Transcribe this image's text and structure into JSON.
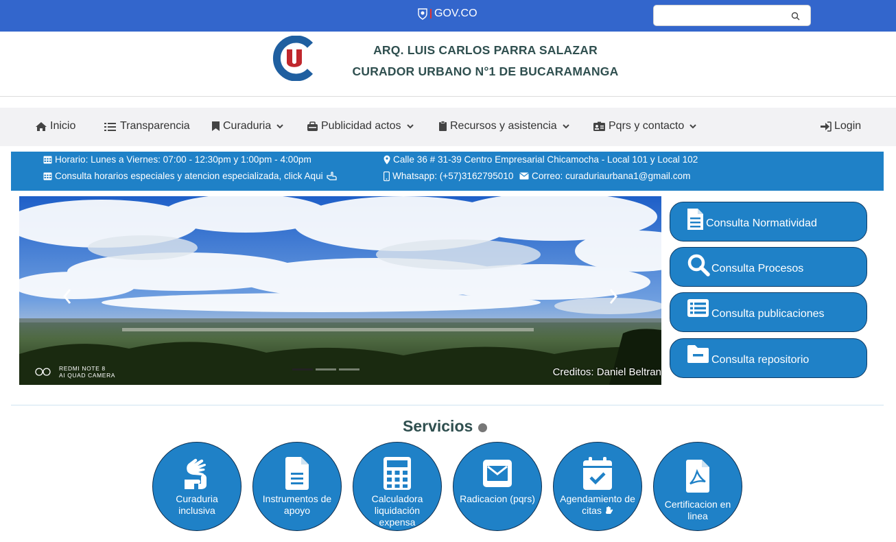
{
  "govbar": {
    "brand": "GOV.CO",
    "search_placeholder": ""
  },
  "header": {
    "title_line1": "ARQ. LUIS CARLOS PARRA SALAZAR",
    "title_line2": "CURADOR URBANO N°1 DE BUCARAMANGA",
    "logo_text": "U1"
  },
  "nav": {
    "items": [
      {
        "label": "Inicio",
        "icon": "home-icon"
      },
      {
        "label": "Transparencia",
        "icon": "list-icon"
      },
      {
        "label": "Curaduria",
        "icon": "bookmark-icon"
      },
      {
        "label": "Publicidad actos",
        "icon": "toolbox-icon"
      },
      {
        "label": "Recursos y asistencia",
        "icon": "clipboard-icon"
      },
      {
        "label": "Pqrs y contacto",
        "icon": "id-badge-icon"
      }
    ],
    "login": "Login"
  },
  "info": {
    "schedule": "Horario: Lunes a Viernes: 07:00 - 12:30pm y 1:00pm - 4:00pm",
    "special": "Consulta horarios especiales y atencion especializada, click Aqui",
    "address": "Calle 36 # 31-39 Centro Empresarial Chicamocha - Local 101 y Local 102",
    "whatsapp": "Whatsapp: (+57)3162795010",
    "email": "Correo: curaduriaurbana1@gmail.com"
  },
  "carousel": {
    "credit": "Creditos: Daniel Beltran",
    "camera_line1": "REDMI NOTE 8",
    "camera_line2": "AI QUAD CAMERA",
    "slides": 3,
    "active_slide": 1
  },
  "side_buttons": [
    {
      "label": "Consulta Normatividad",
      "icon": "file-text-icon"
    },
    {
      "label": "Consulta Procesos",
      "icon": "search-icon"
    },
    {
      "label": "Consulta publicaciones",
      "icon": "list-alt-icon"
    },
    {
      "label": "Consulta repositorio",
      "icon": "folder-minus-icon"
    }
  ],
  "services": {
    "title": "Servicios",
    "items": [
      {
        "label": "Curaduria inclusiva",
        "icon": "sign-language-icon"
      },
      {
        "label": "Instrumentos de apoyo",
        "icon": "file-alt-icon"
      },
      {
        "label": "Calculadora liquidación expensa",
        "icon": "calculator-icon"
      },
      {
        "label": "Radicacion (pqrs)",
        "icon": "envelope-icon"
      },
      {
        "label": "Agendamiento de citas",
        "icon": "calendar-check-icon"
      },
      {
        "label": "Certificacion en linea",
        "icon": "file-pdf-icon"
      }
    ]
  },
  "colors": {
    "gov_blue": "#3366cc",
    "primary_blue": "#1f81c7",
    "title_dark": "#2f4f4f",
    "logo_red": "#c0272d",
    "logo_blue": "#1f5fa0"
  }
}
